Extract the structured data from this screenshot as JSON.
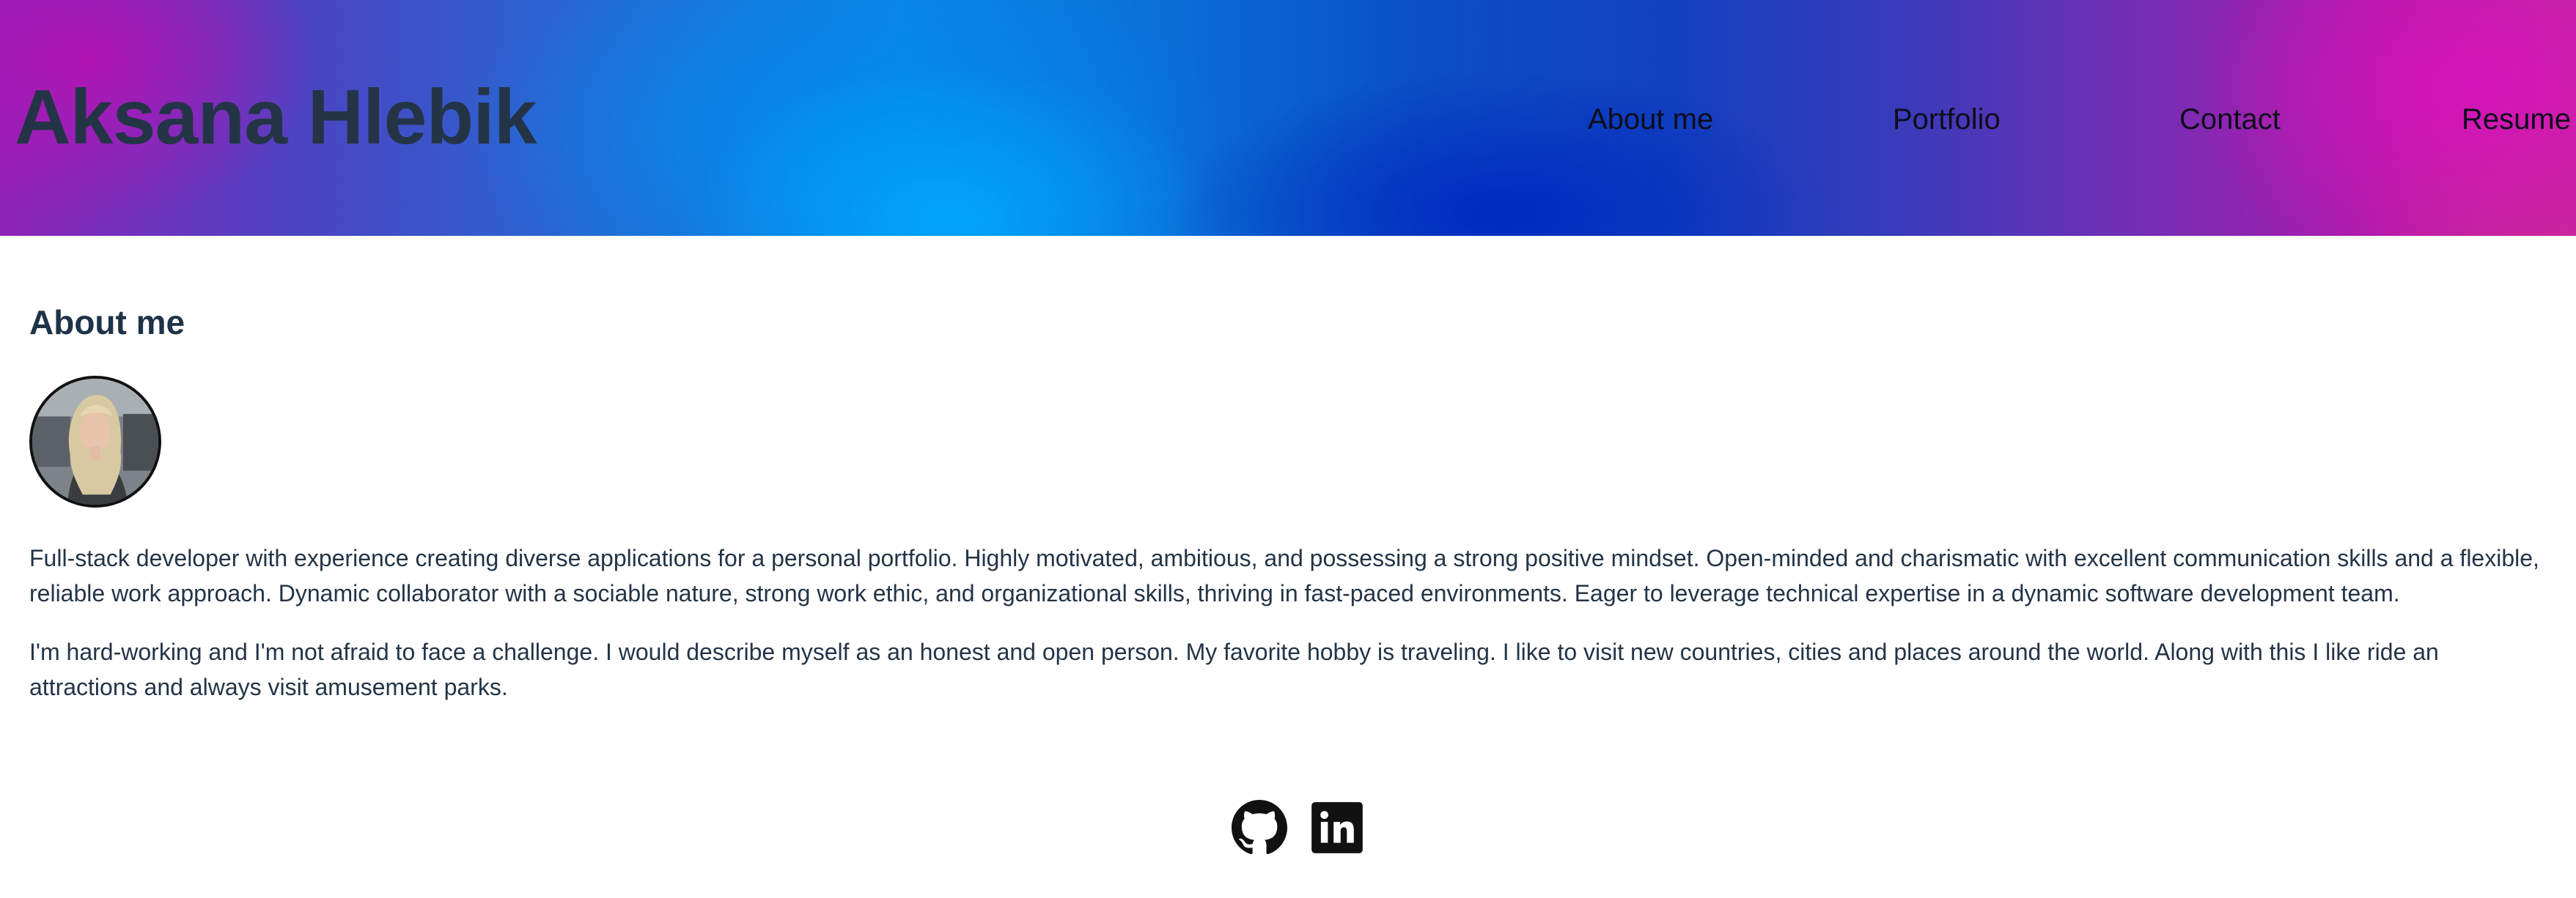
{
  "header": {
    "title": "Aksana Hlebik",
    "nav": [
      {
        "label": "About me"
      },
      {
        "label": "Portfolio"
      },
      {
        "label": "Contact"
      },
      {
        "label": "Resume"
      }
    ]
  },
  "about": {
    "heading": "About me",
    "paragraphs": [
      "Full-stack developer with experience creating diverse applications for a personal portfolio. Highly motivated, ambitious, and possessing a strong positive mindset. Open-minded and charismatic with excellent communication skills and a flexible, reliable work approach. Dynamic collaborator with a sociable nature, strong work ethic, and organizational skills, thriving in fast-paced environments. Eager to leverage technical expertise in a dynamic software development team.",
      "I'm hard-working and I'm not afraid to face a challenge. I would describe myself as an honest and open person. My favorite hobby is traveling. I like to visit new countries, cities and places around the world. Along with this I like ride an attractions and always visit amusement parks."
    ]
  },
  "footer": {
    "icons": [
      "github-icon",
      "linkedin-icon"
    ]
  },
  "colors": {
    "title_text": "#243447",
    "body_text": "#243447",
    "nav_text": "#0d0d1a",
    "header_blue": "#0a86e6",
    "header_magenta": "#b01aa8"
  }
}
